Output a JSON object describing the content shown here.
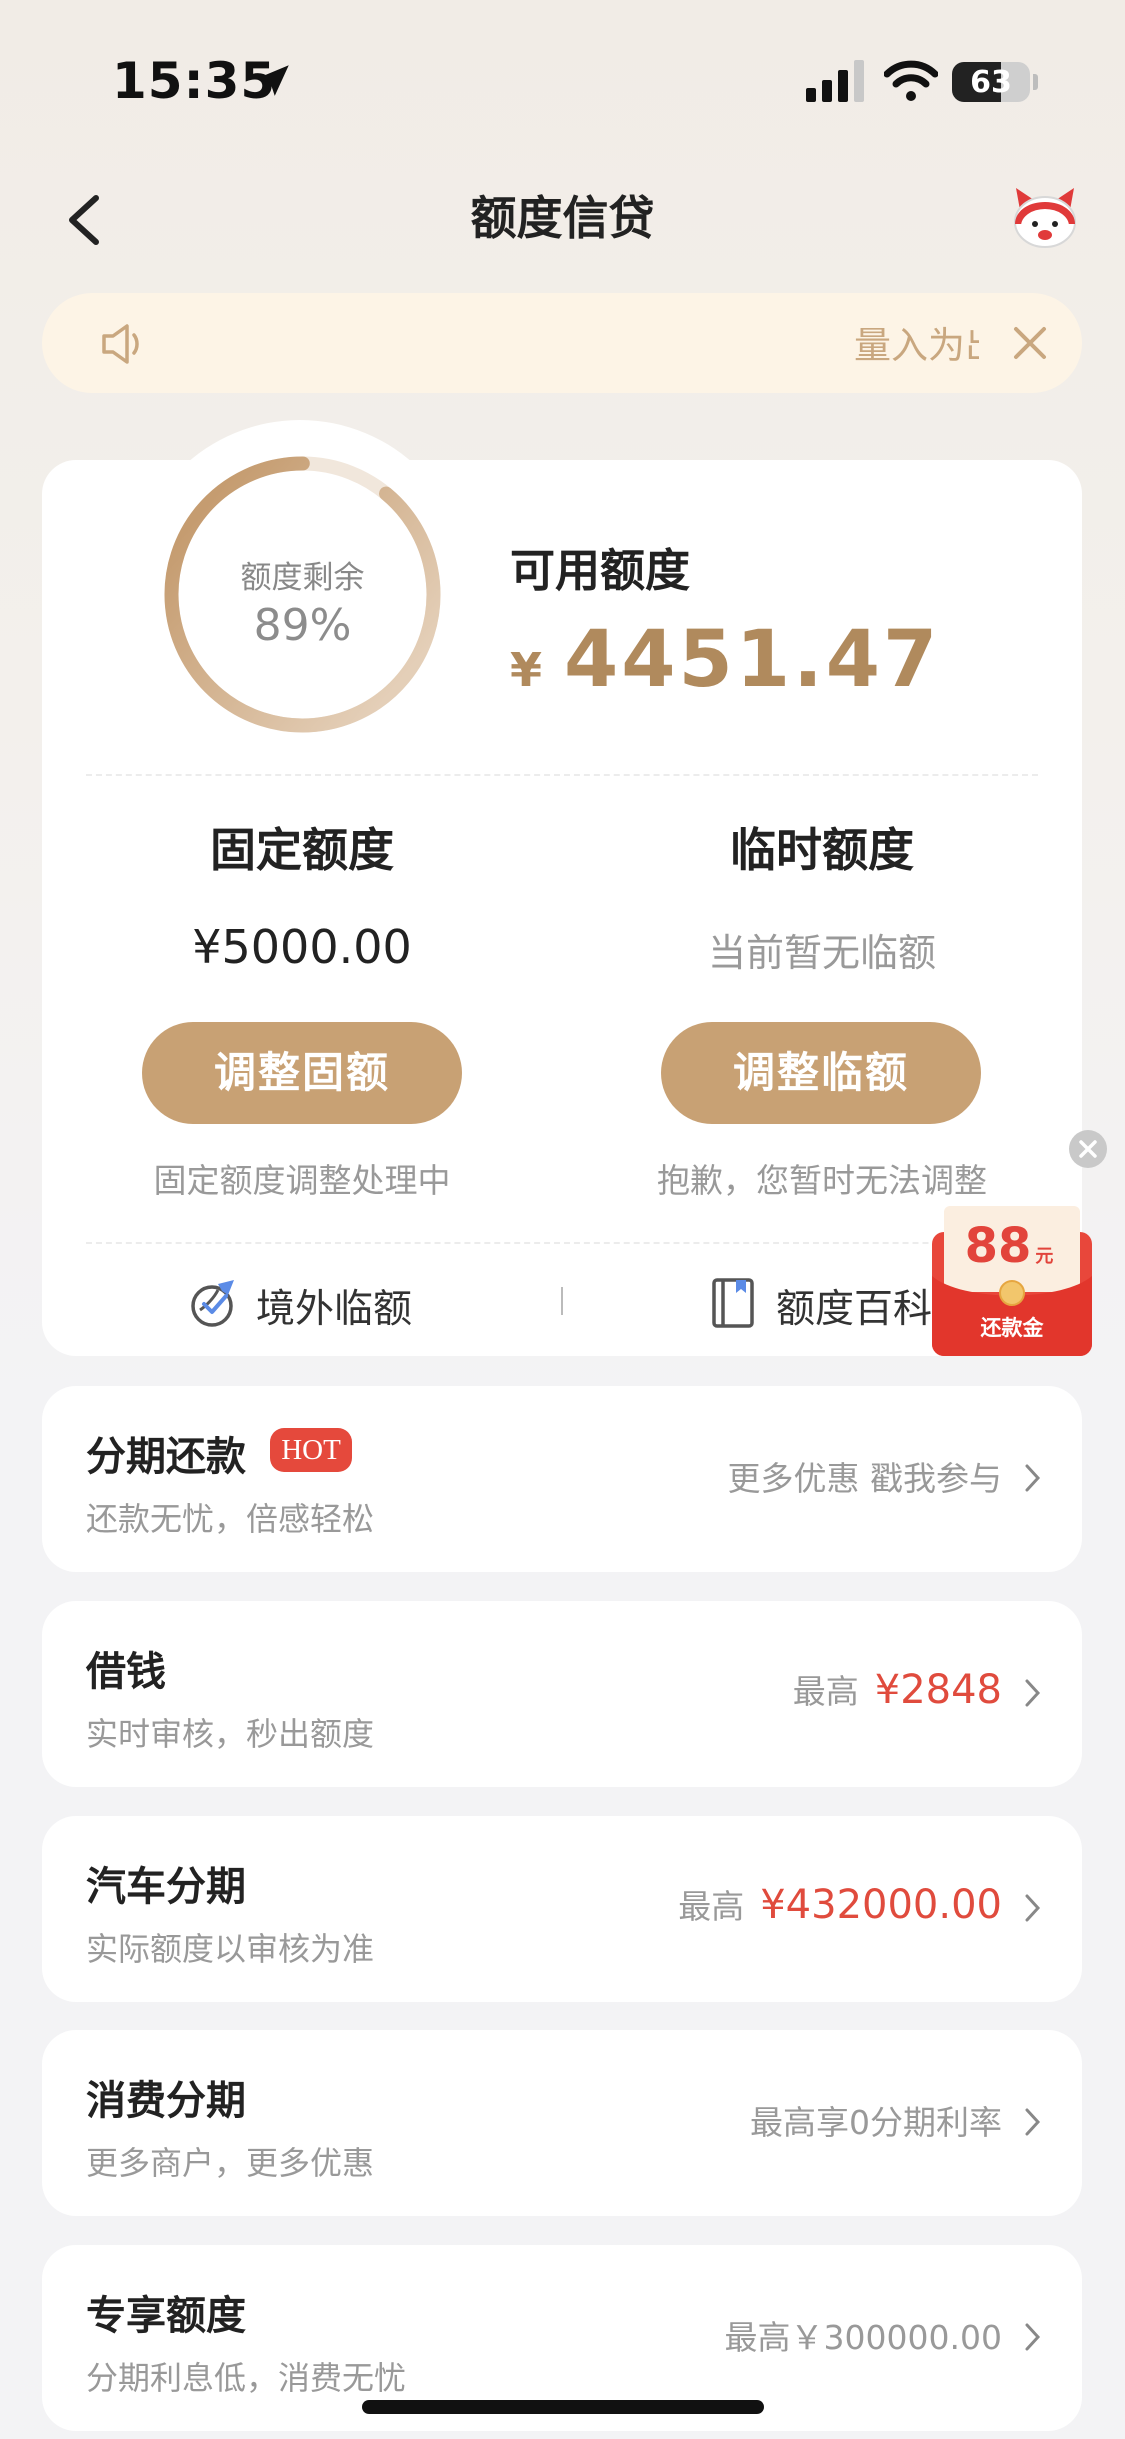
{
  "status": {
    "time": "15:35",
    "battery": "63",
    "battery_level": 0.63
  },
  "nav": {
    "title": "额度信贷"
  },
  "notice": {
    "text": "量入为出"
  },
  "quota": {
    "remaining_label": "额度剩余",
    "remaining_percent": "89%",
    "remaining_fraction": 0.89,
    "available_label": "可用额度",
    "currency": "¥",
    "available_amount": "4451.47",
    "fixed": {
      "title": "固定额度",
      "value": "¥5000.00",
      "button": "调整固额",
      "note": "固定额度调整处理中"
    },
    "temp": {
      "title": "临时额度",
      "value": "当前暂无临额",
      "button": "调整临额",
      "note": "抱歉，您暂时无法调整"
    },
    "links": [
      {
        "label": "境外临额",
        "icon": "globe-plane-icon"
      },
      {
        "label": "额度百科",
        "icon": "book-icon"
      }
    ]
  },
  "red_packet": {
    "amount": "88",
    "unit": "元",
    "label": "还款金"
  },
  "list": [
    {
      "title": "分期还款",
      "badge": "HOT",
      "subtitle": "还款无忧，倍感轻松",
      "right": "更多优惠 戳我参与",
      "highlight": ""
    },
    {
      "title": "借钱",
      "subtitle": "实时审核，秒出额度",
      "right": "最高",
      "highlight": "¥2848"
    },
    {
      "title": "汽车分期",
      "subtitle": "实际额度以审核为准",
      "right": "最高",
      "highlight": "¥432000.00"
    },
    {
      "title": "消费分期",
      "subtitle": "更多商户，更多优惠",
      "right": "最高享0分期利率",
      "highlight": ""
    },
    {
      "title": "专享额度",
      "subtitle": "分期利息低，消费无忧",
      "right": "最高￥300000.00",
      "highlight": ""
    }
  ],
  "colors": {
    "accent": "#c8a174",
    "accent_dark": "#b08a5d",
    "red": "#e04b3d"
  }
}
